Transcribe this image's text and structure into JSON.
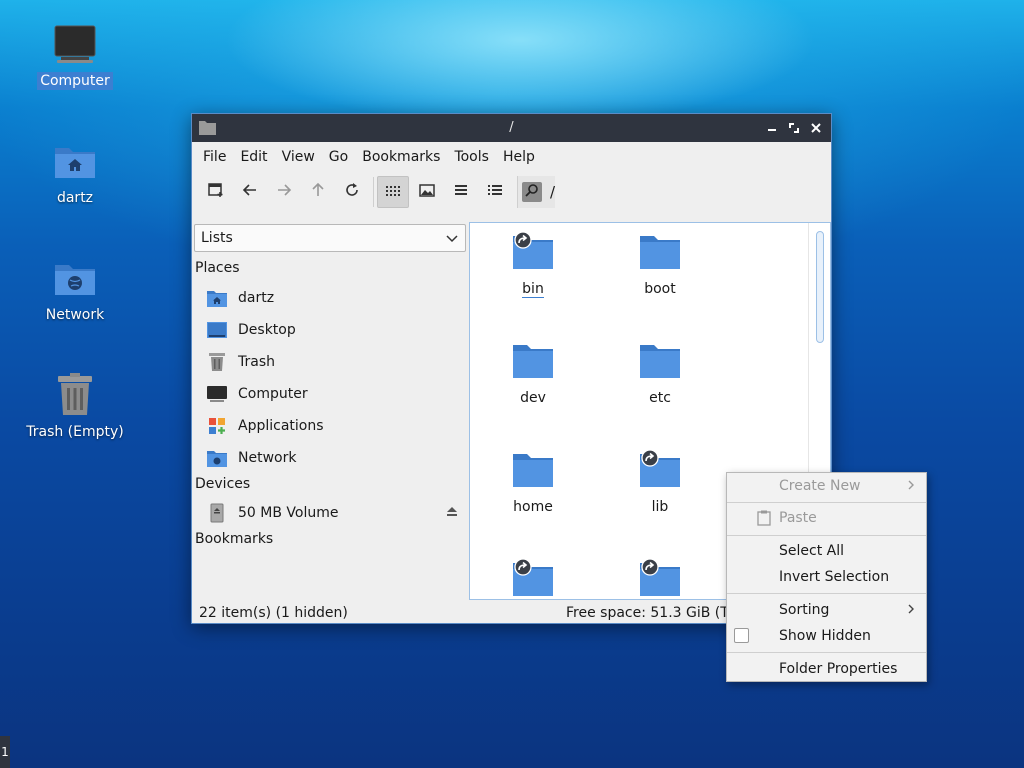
{
  "desktop": {
    "icons": [
      {
        "label": "Computer",
        "icon": "computer-icon"
      },
      {
        "label": "dartz",
        "icon": "home-folder-icon"
      },
      {
        "label": "Network",
        "icon": "network-folder-icon"
      },
      {
        "label": "Trash (Empty)",
        "icon": "trash-icon"
      }
    ]
  },
  "window": {
    "title": "/",
    "menu": [
      "File",
      "Edit",
      "View",
      "Go",
      "Bookmarks",
      "Tools",
      "Help"
    ],
    "path": "/"
  },
  "sidebar": {
    "combo_value": "Lists",
    "places_header": "Places",
    "places": [
      {
        "label": "dartz",
        "icon": "home-folder-icon"
      },
      {
        "label": "Desktop",
        "icon": "desktop-icon"
      },
      {
        "label": "Trash",
        "icon": "trash-icon"
      },
      {
        "label": "Computer",
        "icon": "computer-icon"
      },
      {
        "label": "Applications",
        "icon": "applications-icon"
      },
      {
        "label": "Network",
        "icon": "network-folder-icon"
      }
    ],
    "devices_header": "Devices",
    "devices": [
      {
        "label": "50 MB Volume",
        "icon": "drive-icon"
      }
    ],
    "bookmarks_header": "Bookmarks"
  },
  "files": [
    {
      "name": "bin",
      "symlink": true
    },
    {
      "name": "boot",
      "symlink": false
    },
    {
      "name": "dev",
      "symlink": false
    },
    {
      "name": "etc",
      "symlink": false
    },
    {
      "name": "home",
      "symlink": false
    },
    {
      "name": "lib",
      "symlink": true
    },
    {
      "name": "",
      "symlink": true
    },
    {
      "name": "",
      "symlink": true
    }
  ],
  "status": {
    "items": "22 item(s) (1 hidden)",
    "free_space": "Free space: 51.3 GiB (To"
  },
  "context_menu": {
    "create_new": "Create New",
    "paste": "Paste",
    "select_all": "Select All",
    "invert_selection": "Invert Selection",
    "sorting": "Sorting",
    "show_hidden": "Show Hidden",
    "folder_properties": "Folder Properties"
  },
  "taskbar": {
    "label": "1"
  },
  "colors": {
    "folder": "#5294e2",
    "folder_dark": "#3a7ac8",
    "accent": "#3c7fd1"
  }
}
